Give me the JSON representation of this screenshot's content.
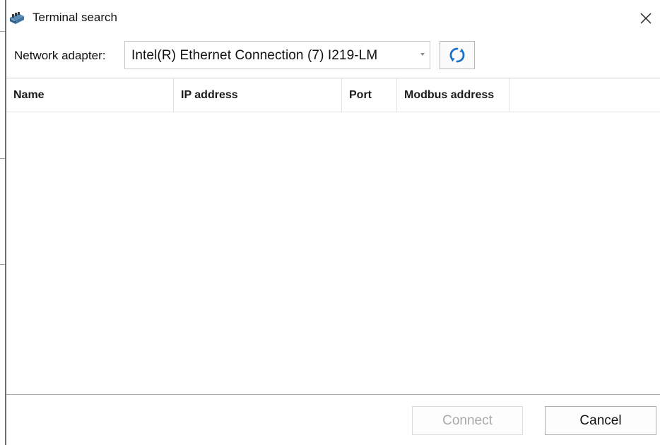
{
  "window": {
    "title": "Terminal search",
    "close_icon": "close-icon"
  },
  "adapter": {
    "label": "Network adapter:",
    "selected": "Intel(R) Ethernet Connection (7) I219-LM",
    "refresh_icon": "refresh-icon"
  },
  "table": {
    "columns": [
      "Name",
      "IP address",
      "Port",
      "Modbus address"
    ],
    "rows": []
  },
  "footer": {
    "connect_label": "Connect",
    "connect_enabled": false,
    "cancel_label": "Cancel"
  },
  "colors": {
    "refresh_accent": "#1a73c8",
    "disabled_text": "#a8a8a8"
  }
}
